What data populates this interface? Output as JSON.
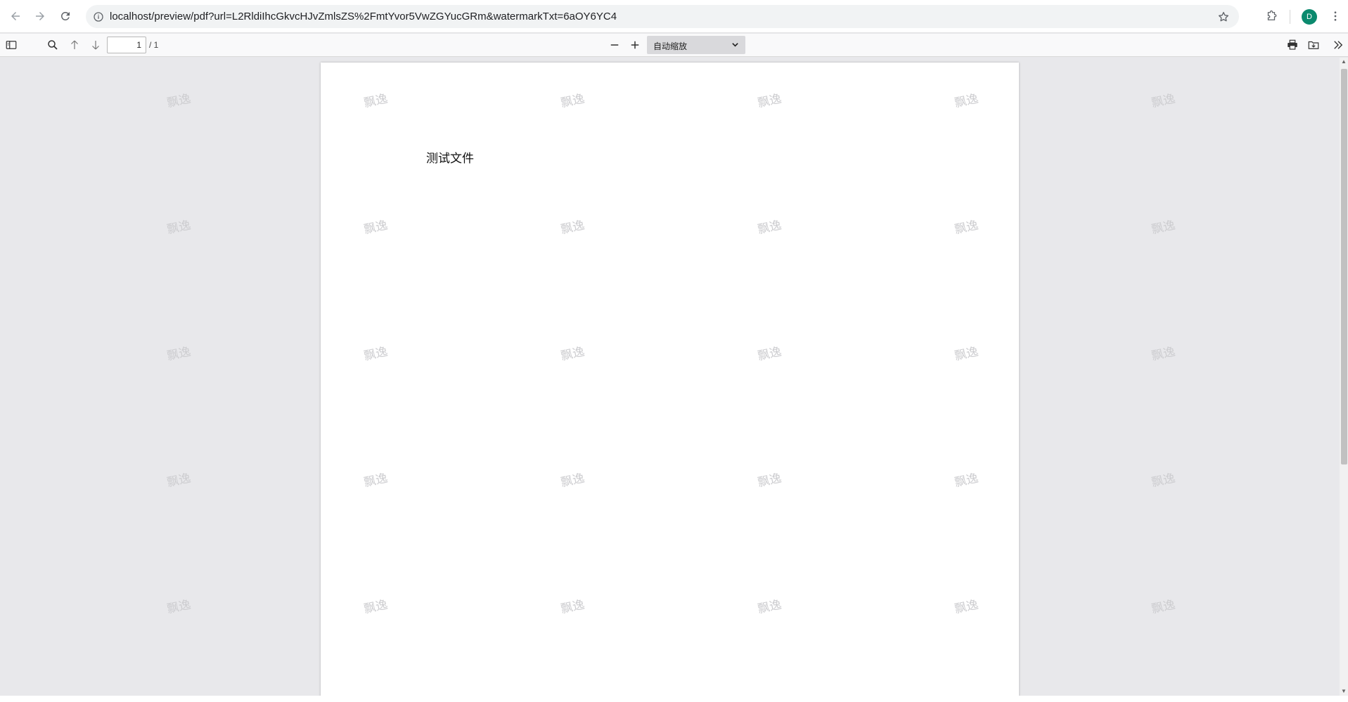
{
  "browser": {
    "url": "localhost/preview/pdf?url=L2RldiIhcGkvcHJvZmlsZS%2FmtYvor5VwZGYucGRm&watermarkTxt=6aOY6YC4",
    "profile_initial": "D"
  },
  "pdf_toolbar": {
    "page_number": "1",
    "page_total": "/ 1",
    "zoom_label": "自动缩放"
  },
  "document": {
    "text": "测试文件",
    "watermark": "飘逸"
  },
  "colors": {
    "avatar": "#0b8a6e",
    "viewer_bg": "#e8e8eb",
    "watermark": "#cdcdd0"
  }
}
